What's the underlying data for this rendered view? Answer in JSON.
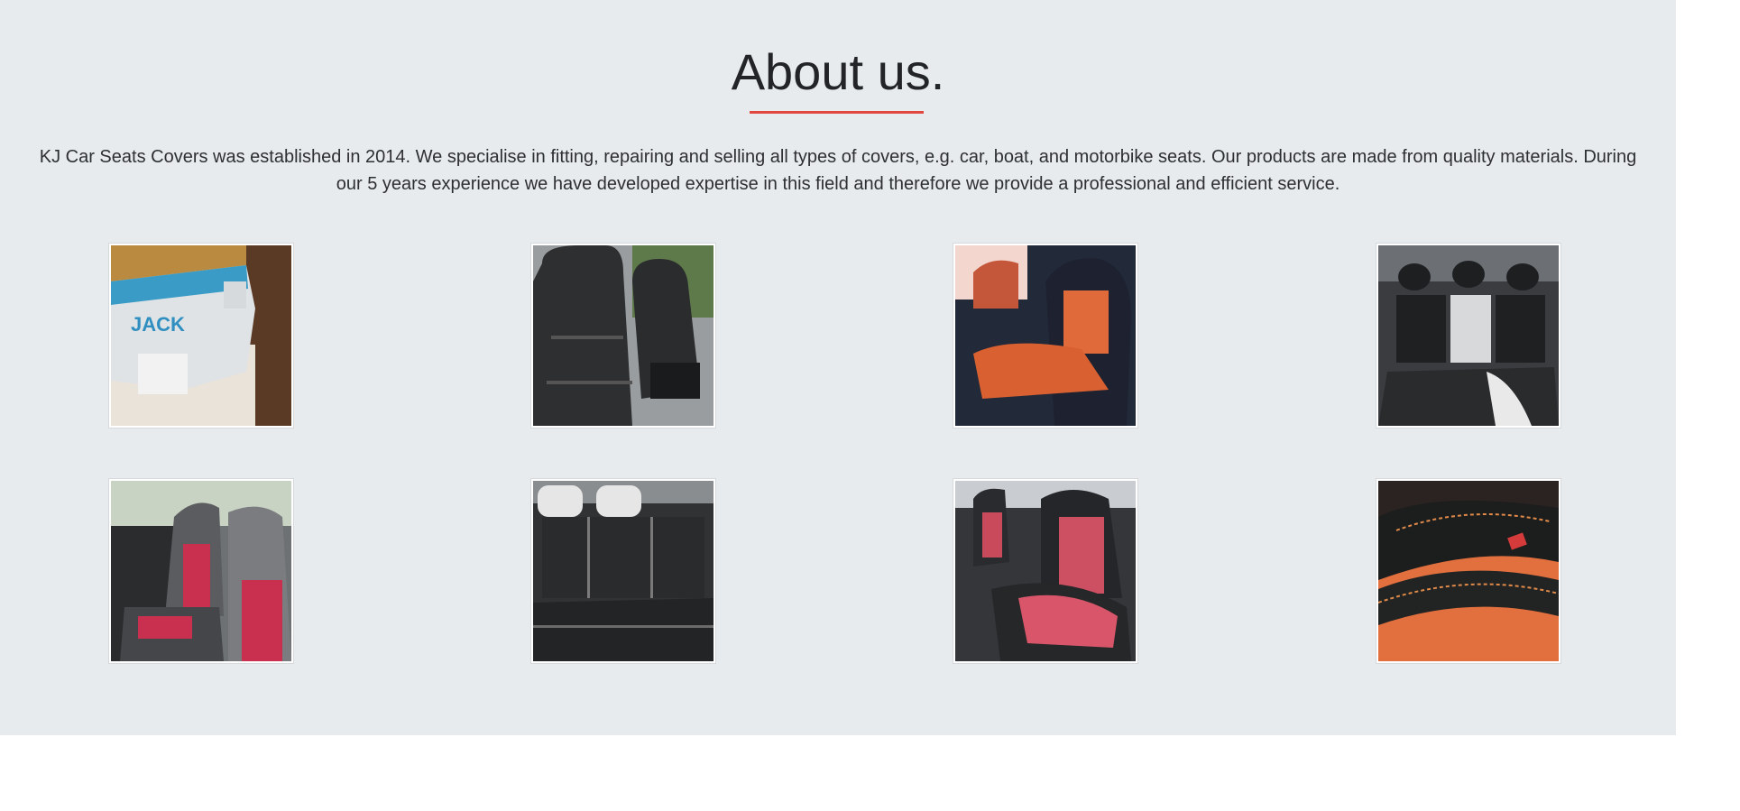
{
  "about": {
    "title": "About us.",
    "accent_color": "#e2473f",
    "background_color": "#e8ebee",
    "description": "KJ Car Seats Covers was established in 2014. We specialise in fitting, repairing and selling all types of covers, e.g. car, boat, and motorbike seats. Our products are made from quality materials. During our 5 years experience we have developed expertise in this field and therefore we provide a professional and efficient service."
  },
  "gallery": {
    "images": [
      {
        "subject": "sewing-machine-photo"
      },
      {
        "subject": "black-leather-front-seats-photo"
      },
      {
        "subject": "orange-black-front-seat-photo"
      },
      {
        "subject": "black-white-rear-seats-photo"
      },
      {
        "subject": "red-grey-front-seats-photo"
      },
      {
        "subject": "black-rear-bench-photo"
      },
      {
        "subject": "red-black-front-seat-photo"
      },
      {
        "subject": "orange-stitched-armrest-photo"
      }
    ]
  }
}
